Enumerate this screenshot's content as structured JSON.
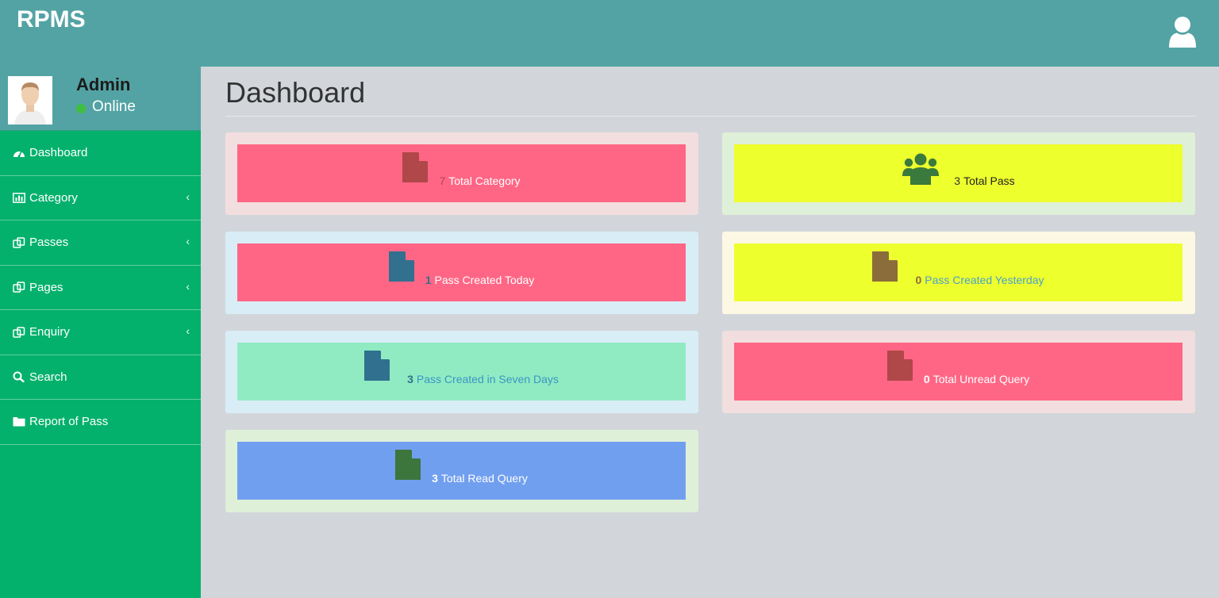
{
  "header": {
    "brand": "RPMS"
  },
  "user": {
    "name": "Admin",
    "status": "Online"
  },
  "sidebar": {
    "items": [
      {
        "label": "Dashboard",
        "icon": "dashboard-icon",
        "has_submenu": false
      },
      {
        "label": "Category",
        "icon": "bar-chart-icon",
        "has_submenu": true
      },
      {
        "label": "Passes",
        "icon": "copy-icon",
        "has_submenu": true
      },
      {
        "label": "Pages",
        "icon": "copy-icon",
        "has_submenu": true
      },
      {
        "label": "Enquiry",
        "icon": "copy-icon",
        "has_submenu": true
      },
      {
        "label": "Search",
        "icon": "search-icon",
        "has_submenu": false
      },
      {
        "label": "Report of Pass",
        "icon": "folder-icon",
        "has_submenu": false
      }
    ],
    "chevron": "‹"
  },
  "main": {
    "title": "Dashboard",
    "cards": [
      {
        "count": "7",
        "label": "Total Category",
        "icon": "file-icon"
      },
      {
        "count": "3",
        "label": "Total Pass",
        "icon": "users-icon"
      },
      {
        "count": "1",
        "label": "Pass Created Today",
        "icon": "file-icon"
      },
      {
        "count": "0",
        "label": "Pass Created Yesterday",
        "icon": "file-icon"
      },
      {
        "count": "3",
        "label": "Pass Created in Seven Days",
        "icon": "file-icon"
      },
      {
        "count": "0",
        "label": "Total Unread Query",
        "icon": "file-icon"
      },
      {
        "count": "3",
        "label": "Total Read Query",
        "icon": "file-icon"
      }
    ]
  },
  "colors": {
    "header": "#53a3a4",
    "sidebar": "#04b16c",
    "content_bg": "#d2d6db",
    "card_pink": "#ff6685",
    "card_yellow": "#eeff2e",
    "card_mint": "#90ebc2",
    "card_blue": "#719ff0"
  }
}
